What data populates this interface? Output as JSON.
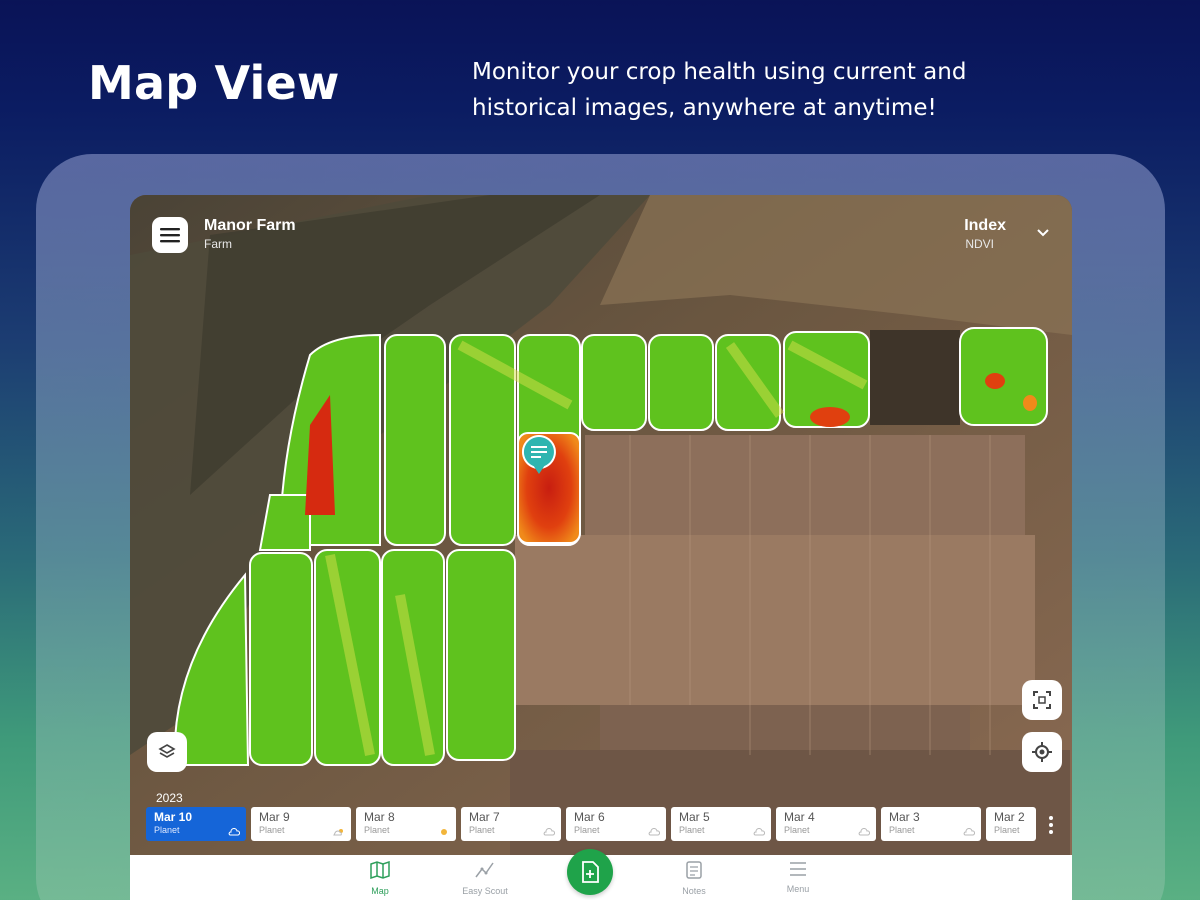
{
  "promo": {
    "title": "Map View",
    "subtitle": "Monitor your crop health using current and historical images, anywhere at anytime!"
  },
  "header": {
    "farm_name": "Manor Farm",
    "farm_type": "Farm",
    "index_label": "Index",
    "index_value": "NDVI"
  },
  "timeline": {
    "year": "2023",
    "dates": [
      {
        "date": "Mar 10",
        "source": "Planet",
        "active": true
      },
      {
        "date": "Mar 9",
        "source": "Planet",
        "active": false
      },
      {
        "date": "Mar 8",
        "source": "Planet",
        "active": false
      },
      {
        "date": "Mar 7",
        "source": "Planet",
        "active": false
      },
      {
        "date": "Mar 6",
        "source": "Planet",
        "active": false
      },
      {
        "date": "Mar 5",
        "source": "Planet",
        "active": false
      },
      {
        "date": "Mar 4",
        "source": "Planet",
        "active": false
      },
      {
        "date": "Mar 3",
        "source": "Planet",
        "active": false
      },
      {
        "date": "Mar 2",
        "source": "Planet",
        "active": false
      }
    ]
  },
  "nav": {
    "items": [
      {
        "label": "Map",
        "icon": "map-icon",
        "active": true
      },
      {
        "label": "Easy Scout",
        "icon": "scout-icon",
        "active": false
      },
      {
        "label": "Notes",
        "icon": "notes-icon",
        "active": false
      },
      {
        "label": "Menu",
        "icon": "menu-icon",
        "active": false
      }
    ]
  },
  "icons": {
    "header_menu": "hamburger-icon",
    "index_dropdown": "chevron-down-icon",
    "layers": "layers-icon",
    "fit_view": "fit-view-icon",
    "locate": "locate-icon",
    "scout_pin": "note-pin-icon",
    "add_report": "add-report-icon",
    "more": "more-vert-icon"
  },
  "colors": {
    "active_date": "#1565d8",
    "fab": "#1fa34a",
    "nav_active": "#2e9f5b",
    "ndvi_high": "#5fc21e",
    "ndvi_low": "#d42a10"
  }
}
